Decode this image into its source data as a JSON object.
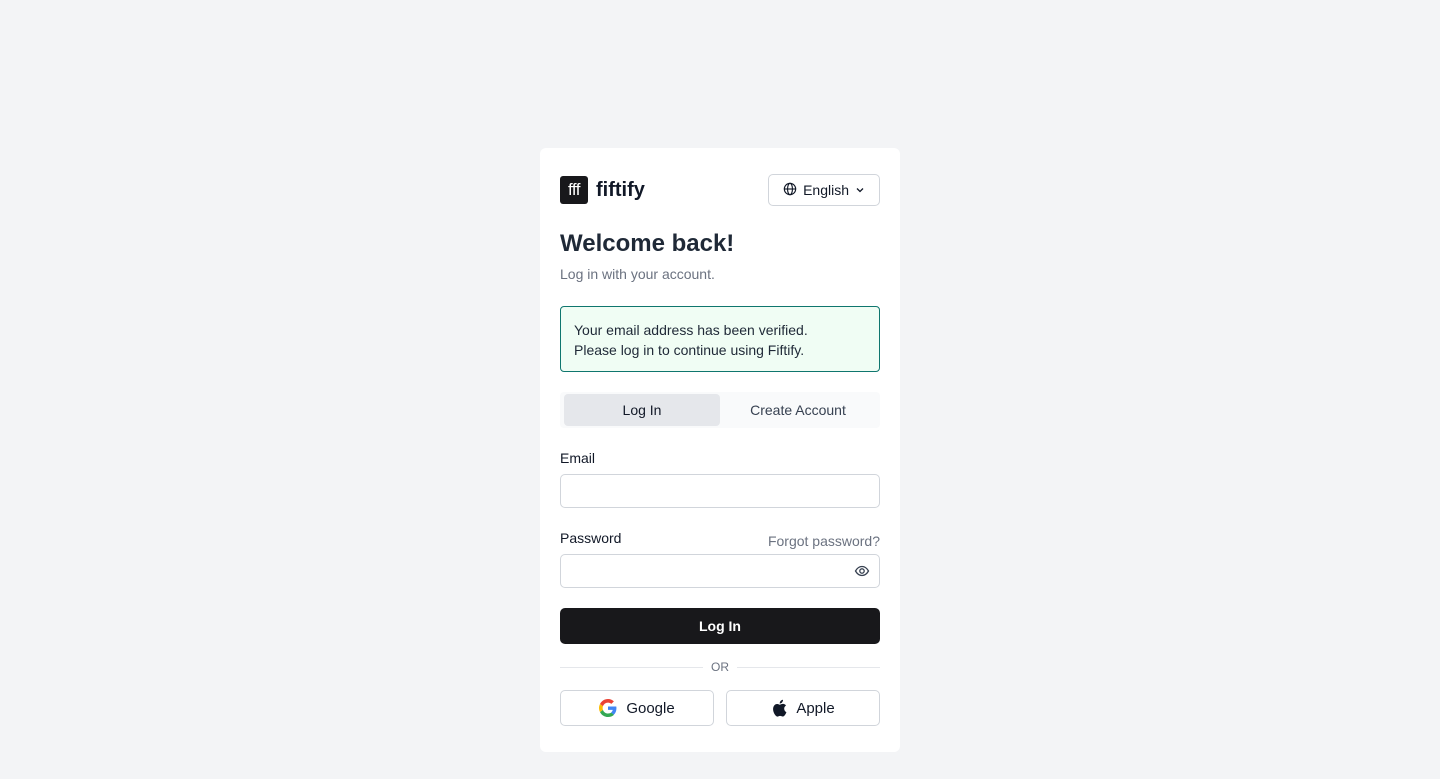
{
  "brand": {
    "logo_text": "fff",
    "name": "fiftify"
  },
  "language": {
    "label": "English",
    "icon": "globe-icon",
    "chevron": "chevron-down-icon"
  },
  "heading": {
    "title": "Welcome back!",
    "subtitle": "Log in with your account."
  },
  "alert": {
    "line1": "Your email address has been verified.",
    "line2": "Please log in to continue using Fiftify.",
    "border_color": "#0f766e",
    "background_color": "#f0fdf4"
  },
  "tabs": [
    {
      "label": "Log In",
      "active": true
    },
    {
      "label": "Create Account",
      "active": false
    }
  ],
  "form": {
    "email_label": "Email",
    "email_value": "",
    "password_label": "Password",
    "password_value": "",
    "forgot_label": "Forgot password?",
    "submit_label": "Log In"
  },
  "divider": {
    "label": "OR"
  },
  "social": {
    "google_label": "Google",
    "google_icon": "google-icon",
    "apple_label": "Apple",
    "apple_icon": "apple-icon"
  },
  "colors": {
    "primary_button": "#18181b",
    "page_background": "#f3f4f6"
  }
}
